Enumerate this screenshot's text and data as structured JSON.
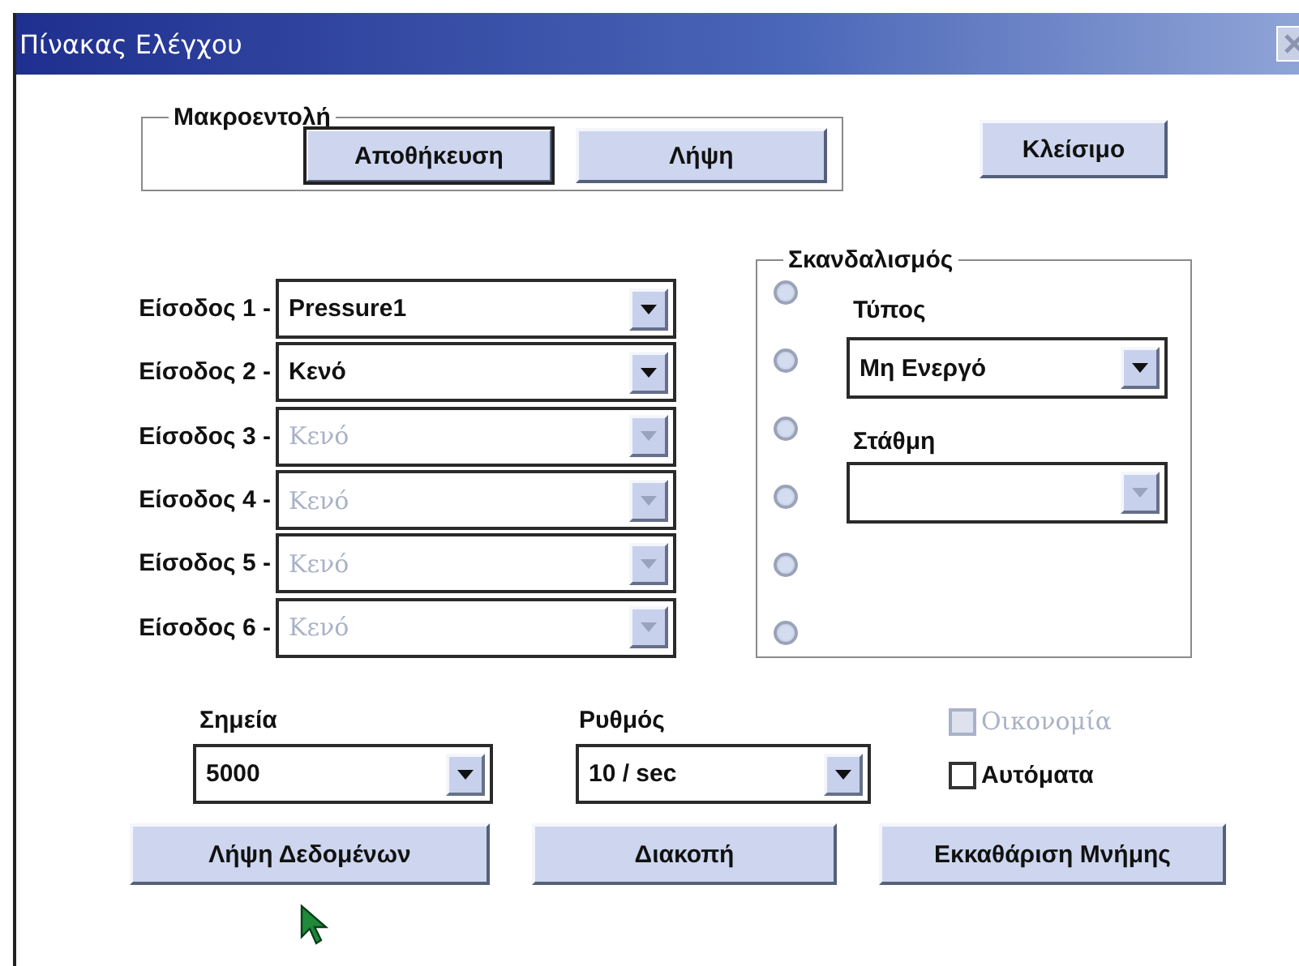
{
  "window": {
    "title": "Πίνακας Ελέγχου"
  },
  "macro": {
    "legend": "Μακροεντολή",
    "buttons": [
      {
        "label": "Αποθήκευση",
        "default": true
      },
      {
        "label": "Λήψη",
        "default": false
      }
    ]
  },
  "close_button": {
    "label": "Κλείσιμο"
  },
  "inputs": [
    {
      "label": "Είσοδος 1 -",
      "value": "Pressure1",
      "disabled": false
    },
    {
      "label": "Είσοδος 2 -",
      "value": "Κενό",
      "disabled": false
    },
    {
      "label": "Είσοδος 3 -",
      "value": "Κενό",
      "disabled": true
    },
    {
      "label": "Είσοδος 4 -",
      "value": "Κενό",
      "disabled": true
    },
    {
      "label": "Είσοδος 5 -",
      "value": "Κενό",
      "disabled": true
    },
    {
      "label": "Είσοδος 6 -",
      "value": "Κενό",
      "disabled": true
    }
  ],
  "scan": {
    "legend": "Σκανδαλισμός",
    "radios": [
      {
        "selected": false
      },
      {
        "selected": false
      },
      {
        "selected": false
      },
      {
        "selected": false
      },
      {
        "selected": false
      },
      {
        "selected": false
      }
    ],
    "type": {
      "label": "Τύπος",
      "value": "Μη Ενεργό",
      "disabled": false
    },
    "level": {
      "label": "Στάθμη",
      "disabled": true
    }
  },
  "points": {
    "label": "Σημεία",
    "value": "5000",
    "disabled": false
  },
  "rate": {
    "label": "Ρυθμός",
    "value": "10 / sec",
    "disabled": false
  },
  "options": [
    {
      "label": "Οικονομία",
      "checked": false,
      "disabled": true
    },
    {
      "label": "Αυτόματα",
      "checked": false,
      "disabled": false
    }
  ],
  "actions": [
    {
      "label": "Λήψη Δεδομένων"
    },
    {
      "label": "Διακοπή"
    },
    {
      "label": "Εκκαθάριση Μνήμης"
    }
  ]
}
